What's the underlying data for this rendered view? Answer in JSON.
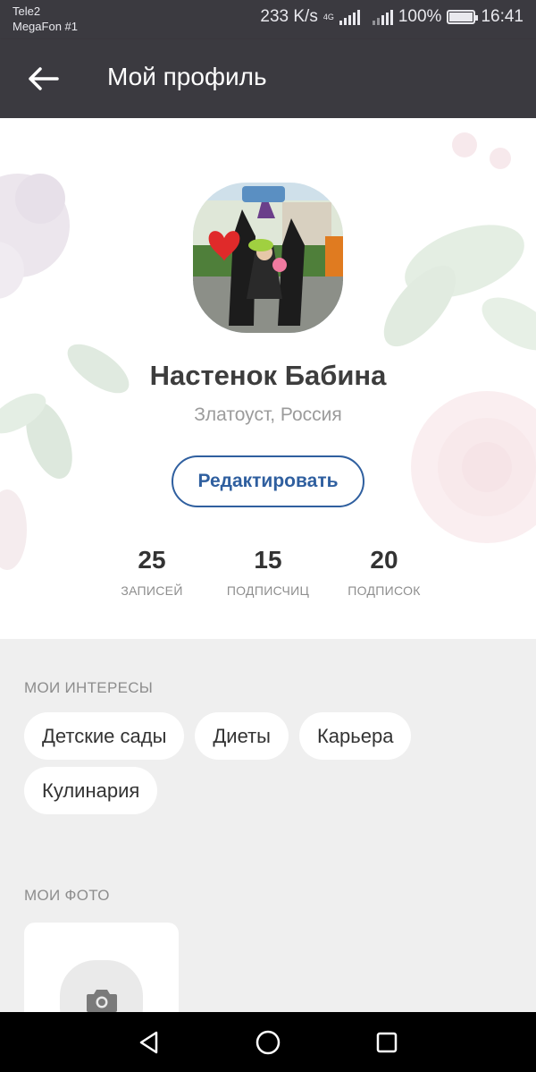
{
  "status_bar": {
    "carrier_1": "Tele2",
    "carrier_2": "MegaFon #1",
    "net_speed": "233 K/s",
    "net_type": "4G",
    "battery": "100%",
    "battery_level": 1.0,
    "time": "16:41"
  },
  "app_bar": {
    "title": "Мой профиль",
    "back_icon": "arrow-left-icon"
  },
  "profile": {
    "name": "Настенок Бабина",
    "location": "Златоуст, Россия",
    "edit_label": "Редактировать",
    "stats": [
      {
        "value": "25",
        "label": "ЗАПИСЕЙ"
      },
      {
        "value": "15",
        "label": "ПОДПИСЧИЦ"
      },
      {
        "value": "20",
        "label": "ПОДПИСОК"
      }
    ]
  },
  "interests": {
    "title": "МОИ ИНТЕРЕСЫ",
    "items": [
      "Детские сады",
      "Диеты",
      "Карьера",
      "Кулинария"
    ]
  },
  "photos": {
    "title": "МОИ ФОТО",
    "add_icon": "camera-icon"
  },
  "nav_bar": {
    "back_icon": "triangle-back-icon",
    "home_icon": "circle-home-icon",
    "recents_icon": "square-recents-icon"
  },
  "colors": {
    "app_bar": "#3b3a40",
    "accent": "#2f5f9f",
    "background": "#efefef"
  }
}
